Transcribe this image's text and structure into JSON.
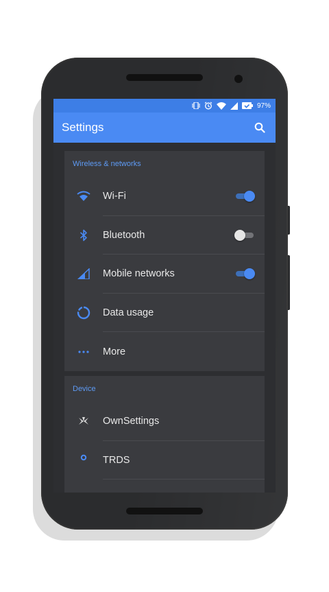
{
  "status_bar": {
    "battery_percent": "97%",
    "icons": [
      "vibrate-icon",
      "alarm-icon",
      "wifi-icon",
      "signal-icon",
      "battery-icon"
    ]
  },
  "app_bar": {
    "title": "Settings",
    "search_icon": "search-icon"
  },
  "colors": {
    "accent": "#4a8af3",
    "status_bar": "#3d7ee6",
    "card_bg": "#3a3b3f",
    "section_title": "#5e9bf5"
  },
  "sections": [
    {
      "title": "Wireless & networks",
      "items": [
        {
          "label": "Wi-Fi",
          "icon": "wifi-icon",
          "toggle": true
        },
        {
          "label": "Bluetooth",
          "icon": "bluetooth-icon",
          "toggle": false
        },
        {
          "label": "Mobile networks",
          "icon": "cell-signal-icon",
          "toggle": true
        },
        {
          "label": "Data usage",
          "icon": "data-usage-icon"
        },
        {
          "label": "More",
          "icon": "more-dots-icon"
        }
      ]
    },
    {
      "title": "Device",
      "items": [
        {
          "label": "OwnSettings",
          "icon": "ownsettings-icon"
        },
        {
          "label": "TRDS",
          "icon": "trds-icon"
        }
      ]
    }
  ]
}
